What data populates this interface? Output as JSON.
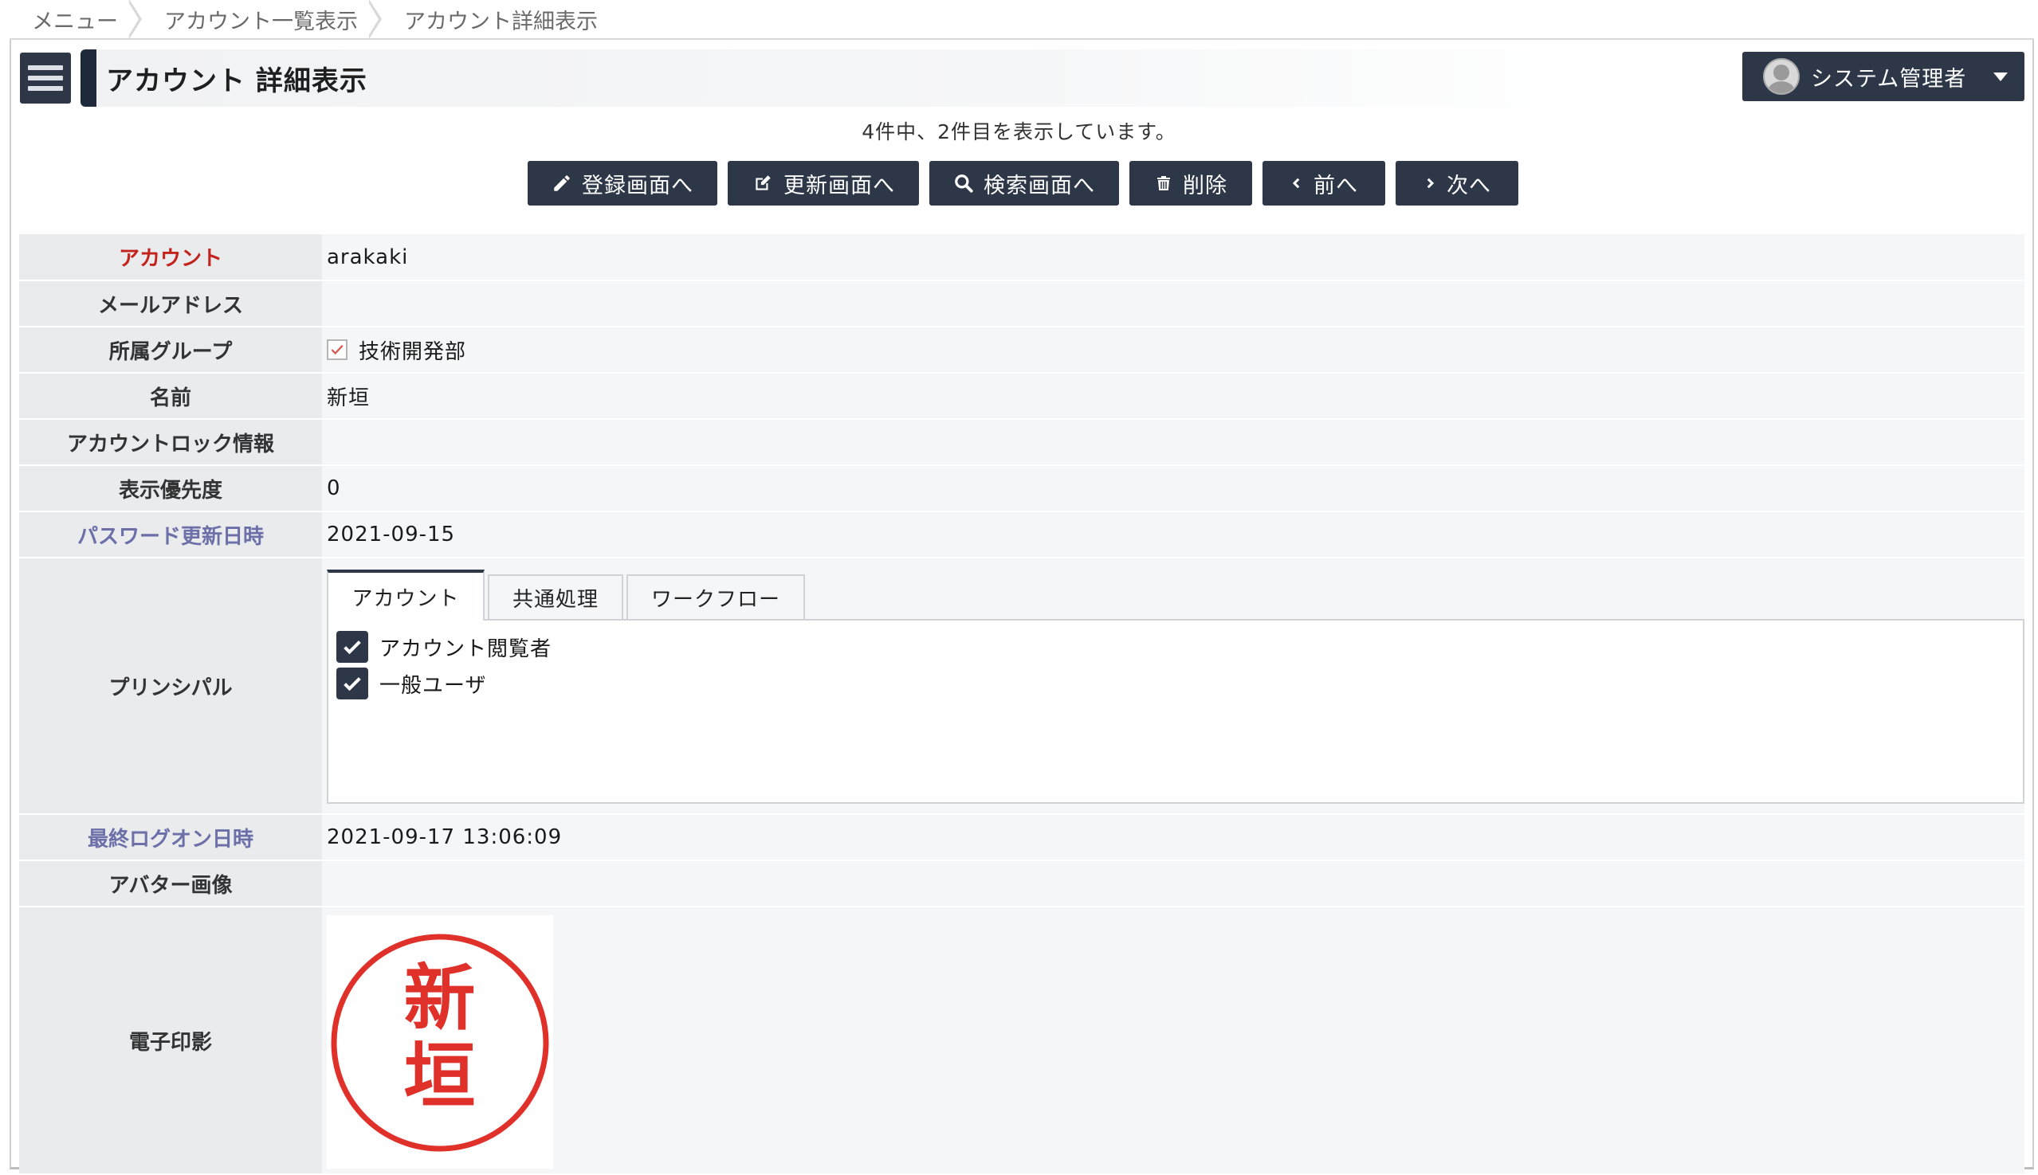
{
  "breadcrumb": [
    {
      "label": "メニュー"
    },
    {
      "label": "アカウント一覧表示"
    },
    {
      "label": "アカウント詳細表示"
    }
  ],
  "header": {
    "title": "アカウント 詳細表示",
    "user_name": "システム管理者"
  },
  "status_text": "4件中、2件目を表示しています。",
  "toolbar": {
    "register": "登録画面へ",
    "update": "更新画面へ",
    "search": "検索画面へ",
    "delete": "削除",
    "prev": "前へ",
    "next": "次へ"
  },
  "fields": {
    "account": {
      "label": "アカウント",
      "value": "arakaki"
    },
    "email": {
      "label": "メールアドレス",
      "value": ""
    },
    "group": {
      "label": "所属グループ",
      "value": "技術開発部",
      "checked": true
    },
    "name": {
      "label": "名前",
      "value": "新垣"
    },
    "lock": {
      "label": "アカウントロック情報",
      "value": ""
    },
    "priority": {
      "label": "表示優先度",
      "value": "0"
    },
    "password_updated": {
      "label": "パスワード更新日時",
      "value": "2021-09-15"
    },
    "principal": {
      "label": "プリンシパル"
    },
    "last_logon": {
      "label": "最終ログオン日時",
      "value": "2021-09-17 13:06:09"
    },
    "avatar": {
      "label": "アバター画像",
      "value": ""
    },
    "seal": {
      "label": "電子印影",
      "char1": "新",
      "char2": "垣"
    }
  },
  "principal_tabs": [
    {
      "label": "アカウント",
      "active": true
    },
    {
      "label": "共通処理",
      "active": false
    },
    {
      "label": "ワークフロー",
      "active": false
    }
  ],
  "principals": [
    {
      "label": "アカウント閲覧者",
      "checked": true
    },
    {
      "label": "一般ユーザ",
      "checked": true
    }
  ],
  "colors": {
    "button_bg": "#2d3748",
    "required_label": "#c3231c",
    "readonly_label": "#6c6fa8",
    "seal_red": "#e0302a"
  }
}
